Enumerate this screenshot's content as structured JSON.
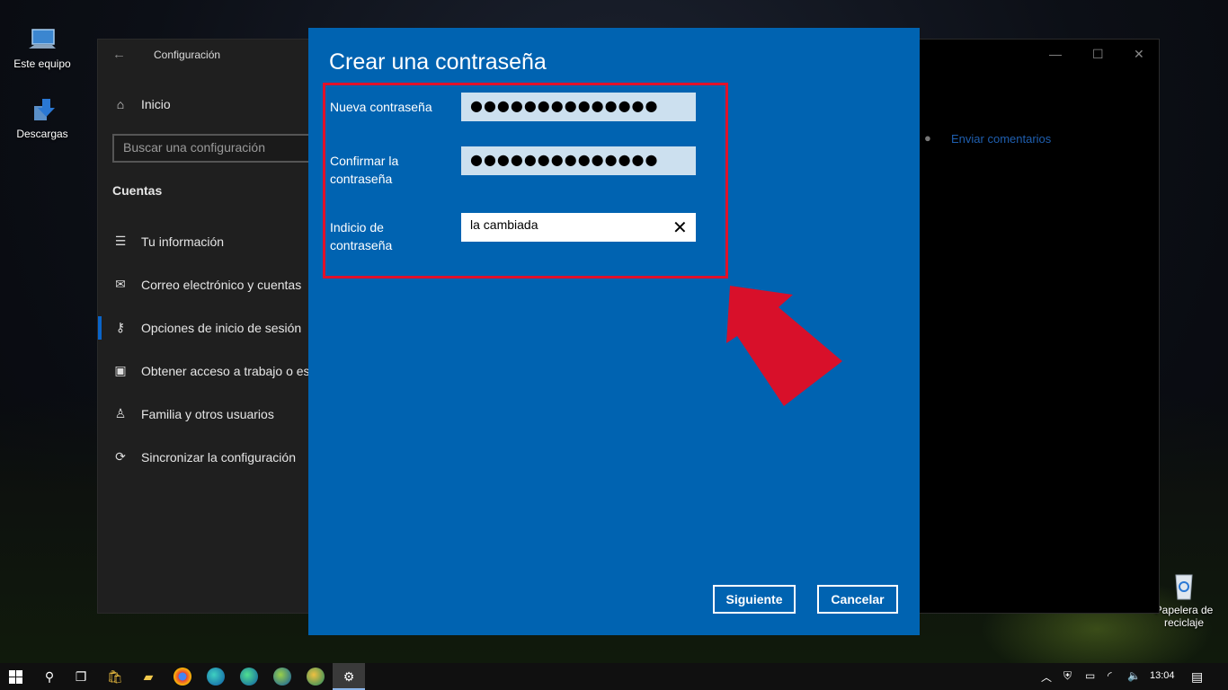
{
  "desktop": {
    "icons": [
      {
        "label": "Este equipo"
      },
      {
        "label": "Descargas"
      },
      {
        "label": "Papelera de reciclaje"
      }
    ]
  },
  "settings": {
    "window_title": "Configuración",
    "nav_home": "Inicio",
    "search_placeholder": "Buscar una configuración",
    "section": "Cuentas",
    "items": [
      {
        "label": "Tu información",
        "icon": "person-card-icon"
      },
      {
        "label": "Correo electrónico y cuentas",
        "icon": "mail-icon"
      },
      {
        "label": "Opciones de inicio de sesión",
        "icon": "key-icon"
      },
      {
        "label": "Obtener acceso a trabajo o escuela",
        "icon": "briefcase-icon"
      },
      {
        "label": "Familia y otros usuarios",
        "icon": "person-add-icon"
      },
      {
        "label": "Sincronizar la configuración",
        "icon": "sync-icon"
      }
    ],
    "feedback_link": "Enviar comentarios",
    "accent_color": "#0063b1"
  },
  "dialog": {
    "title": "Crear una contraseña",
    "new_password_label": "Nueva contraseña",
    "new_password_value": "●●●●●●●●●●●●●●",
    "confirm_label": "Confirmar la contraseña",
    "confirm_value": "●●●●●●●●●●●●●●",
    "hint_label": "Indicio de contraseña",
    "hint_value": "la cambiada",
    "next_button": "Siguiente",
    "cancel_button": "Cancelar",
    "highlight_color": "#e0112b"
  },
  "taskbar": {
    "time": "13:04"
  }
}
